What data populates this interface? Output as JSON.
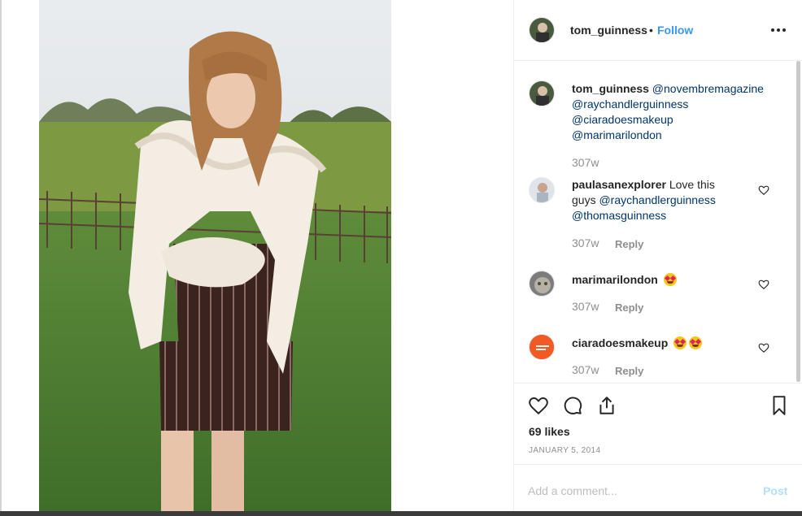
{
  "post": {
    "author": "tom_guinness",
    "separator": "•",
    "follow_label": "Follow",
    "more_icon": "more-options-icon",
    "image_description_icon": "post-photo"
  },
  "caption": {
    "username": "tom_guinness",
    "mentions": [
      "@novembremagazine",
      "@raychandlerguinness",
      "@ciaradoesmakeup",
      "@marimarilondon"
    ],
    "time": "307w"
  },
  "comments": [
    {
      "username": "paulasanexplorer",
      "text_line1": "Love this",
      "text_line2": "guys",
      "mention1": "@raychandlerguinness",
      "mention2": "@thomasguinness",
      "time": "307w",
      "reply_label": "Reply"
    },
    {
      "username": "marimarilondon",
      "text": "",
      "emoji": "heart-eyes-emoji",
      "time": "307w",
      "reply_label": "Reply"
    },
    {
      "username": "ciaradoesmakeup",
      "text": "",
      "emoji": "heart-eyes-emoji",
      "time": "307w",
      "reply_label": "Reply"
    }
  ],
  "actions": {
    "likes": "69 likes",
    "date": "JANUARY 5, 2014"
  },
  "add_comment": {
    "placeholder": "Add a comment...",
    "post_label": "Post"
  },
  "colors": {
    "link": "#3897f0",
    "mention": "#003569",
    "muted": "#8e8e8e",
    "post_disabled": "#b2dffc"
  }
}
